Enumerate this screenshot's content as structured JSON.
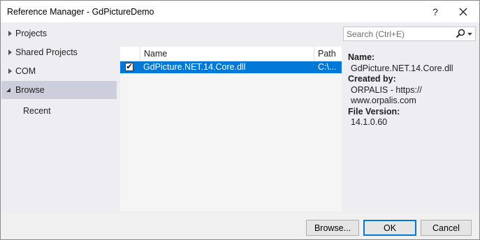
{
  "window": {
    "title": "Reference Manager - GdPictureDemo",
    "help_label": "?",
    "close_label": "✕"
  },
  "nav": {
    "items": [
      {
        "label": "Projects",
        "expanded": false
      },
      {
        "label": "Shared Projects",
        "expanded": false
      },
      {
        "label": "COM",
        "expanded": false
      },
      {
        "label": "Browse",
        "expanded": true,
        "selected": true
      },
      {
        "label": "Recent"
      }
    ]
  },
  "search": {
    "placeholder": "Search (Ctrl+E)",
    "icon": "search-icon"
  },
  "list": {
    "columns": [
      "",
      "Name",
      "Path"
    ],
    "rows": [
      {
        "checked": true,
        "check_glyph": "✔",
        "name": "GdPicture.NET.14.Core.dll",
        "path": "C:\\..."
      }
    ]
  },
  "details": {
    "name_label": "Name:",
    "name_value": "GdPicture.NET.14.Core.dll",
    "created_label": "Created by:",
    "created_value_line1": "ORPALIS - https://",
    "created_value_line2": "www.orpalis.com",
    "version_label": "File Version:",
    "version_value": "14.1.0.60"
  },
  "buttons": {
    "browse": "Browse...",
    "ok": "OK",
    "cancel": "Cancel"
  },
  "colors": {
    "selection": "#0078d7",
    "nav_selected": "#cccedb",
    "background": "#eeeef2"
  }
}
